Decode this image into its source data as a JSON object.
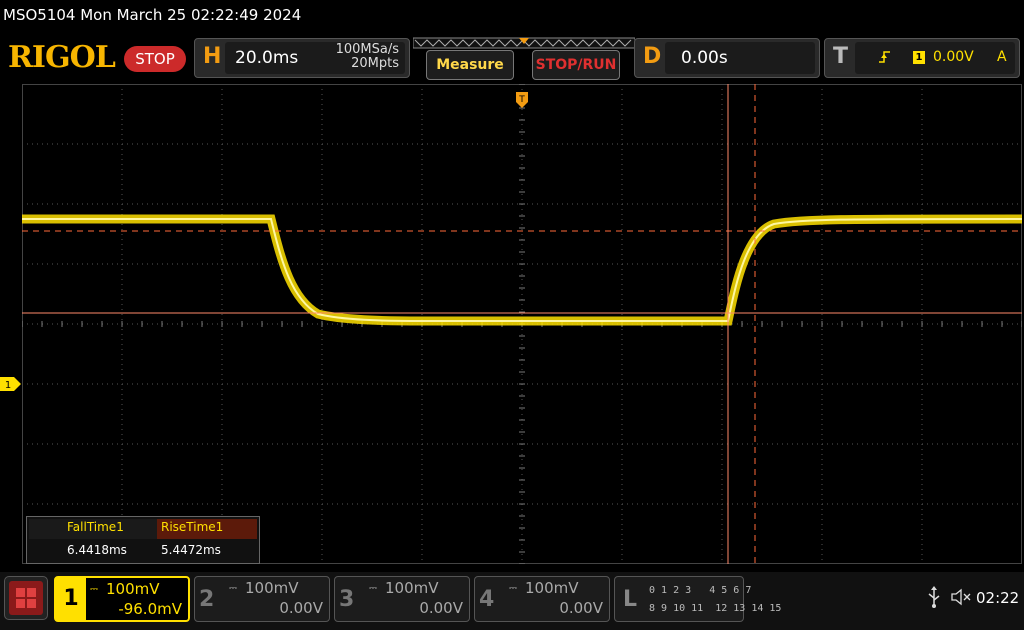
{
  "title_bar": {
    "text": "MSO5104  Mon March 25 02:22:49 2024"
  },
  "toolbar": {
    "logo": "RIGOL",
    "run_status": "STOP",
    "horizontal": {
      "letter": "H",
      "time_base": "20.0ms",
      "sample_rate": "100MSa/s",
      "memory_depth": "20Mpts"
    },
    "measure_label": "Measure",
    "stop_run_label": "STOP/RUN",
    "delay": {
      "letter": "D",
      "value": "0.00s"
    },
    "trigger": {
      "letter": "T",
      "edge_icon": "rising-edge-icon",
      "source": "1",
      "level": "0.00V",
      "mode": "A"
    }
  },
  "grid": {
    "ch1_marker": "1"
  },
  "measurements": {
    "items": [
      {
        "label": "FallTime1",
        "value": "6.4418ms"
      },
      {
        "label": "RiseTime1",
        "value": "5.4472ms"
      }
    ]
  },
  "channels": [
    {
      "num": "1",
      "scale": "100mV",
      "offset": "-96.0mV",
      "active": true,
      "color": "#ffe000"
    },
    {
      "num": "2",
      "scale": "100mV",
      "offset": "0.00V",
      "active": false
    },
    {
      "num": "3",
      "scale": "100mV",
      "offset": "0.00V",
      "active": false
    },
    {
      "num": "4",
      "scale": "100mV",
      "offset": "0.00V",
      "active": false
    }
  ],
  "logic": {
    "letter": "L",
    "row1": "0 1 2 3   4 5 6 7",
    "row2": "8 9 10 11  12 13 14 15"
  },
  "status": {
    "clock": "02:22",
    "icons": [
      "usb-icon",
      "sound-muted-icon"
    ]
  },
  "colors": {
    "trace": "#ffe000",
    "cursor": "#ff6a3a",
    "accent": "#f39c12",
    "stop": "#cc2a2a"
  }
}
